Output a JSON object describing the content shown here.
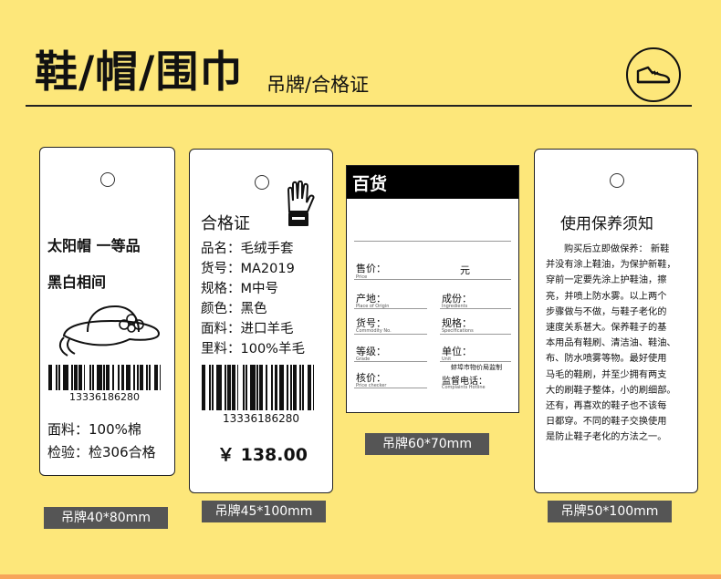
{
  "header": {
    "title": "鞋/帽/围巾",
    "subtitle": "吊牌/合格证"
  },
  "tag1": {
    "line1": "太阳帽 一等品",
    "line2": "黑白相间",
    "barcode_number": "13336186280",
    "material": "面料：100%棉",
    "inspection": "检验：检306合格",
    "size_label": "吊牌40*80mm"
  },
  "tag2": {
    "title": "合格证",
    "rows": [
      "品名：毛绒手套",
      "货号：MA2019",
      "规格：M中号",
      "颜色：黑色",
      "面料：进口羊毛",
      "里料：100%羊毛"
    ],
    "barcode_number": "13336186280",
    "price": "￥ 138.00",
    "size_label": "吊牌45*100mm"
  },
  "tag3": {
    "header": "百货",
    "price_label": "售价：",
    "price_en": "Price",
    "unit": "元",
    "origin": "产地：",
    "origin_en": "Place of Origin",
    "spec": "成份：",
    "spec_en": "Ingredients",
    "item_no": "货号：",
    "item_no_en": "Commodity No.",
    "size": "规格：",
    "size_en": "Specifications",
    "grade": "等级：",
    "grade_en": "Grade",
    "unit_label": "单位：",
    "unit_en": "Unit",
    "checker": "核价：",
    "checker_en": "Price checker",
    "bureau": "蚌埠市物价局监制",
    "hotline": "监督电话：",
    "hotline_en": "Complaints Hotline",
    "size_label": "吊牌60*70mm"
  },
  "tag4": {
    "title": "使用保养须知",
    "lines": [
      "购买后立即做保养： 新鞋",
      "并没有涂上鞋油，为保护新鞋，",
      "穿前一定要先涂上护鞋油，擦",
      "亮，并喷上防水雾。以上两个",
      "步骤做与不做，与鞋子老化的",
      "速度关系甚大。保养鞋子的基",
      "本用品有鞋刷、清洁油、鞋油、",
      "布、防水喷雾等物。最好使用",
      "马毛的鞋刷，并至少拥有两支",
      "大的刷鞋子整体，小的刷细部。",
      "还有，再喜欢的鞋子也不该每",
      "日都穿。不同的鞋子交换使用",
      "是防止鞋子老化的方法之一。"
    ],
    "size_label": "吊牌50*100mm"
  },
  "colors": {
    "background": "#fde77a",
    "label_bg": "#555555",
    "strip": "#f7a65a"
  }
}
